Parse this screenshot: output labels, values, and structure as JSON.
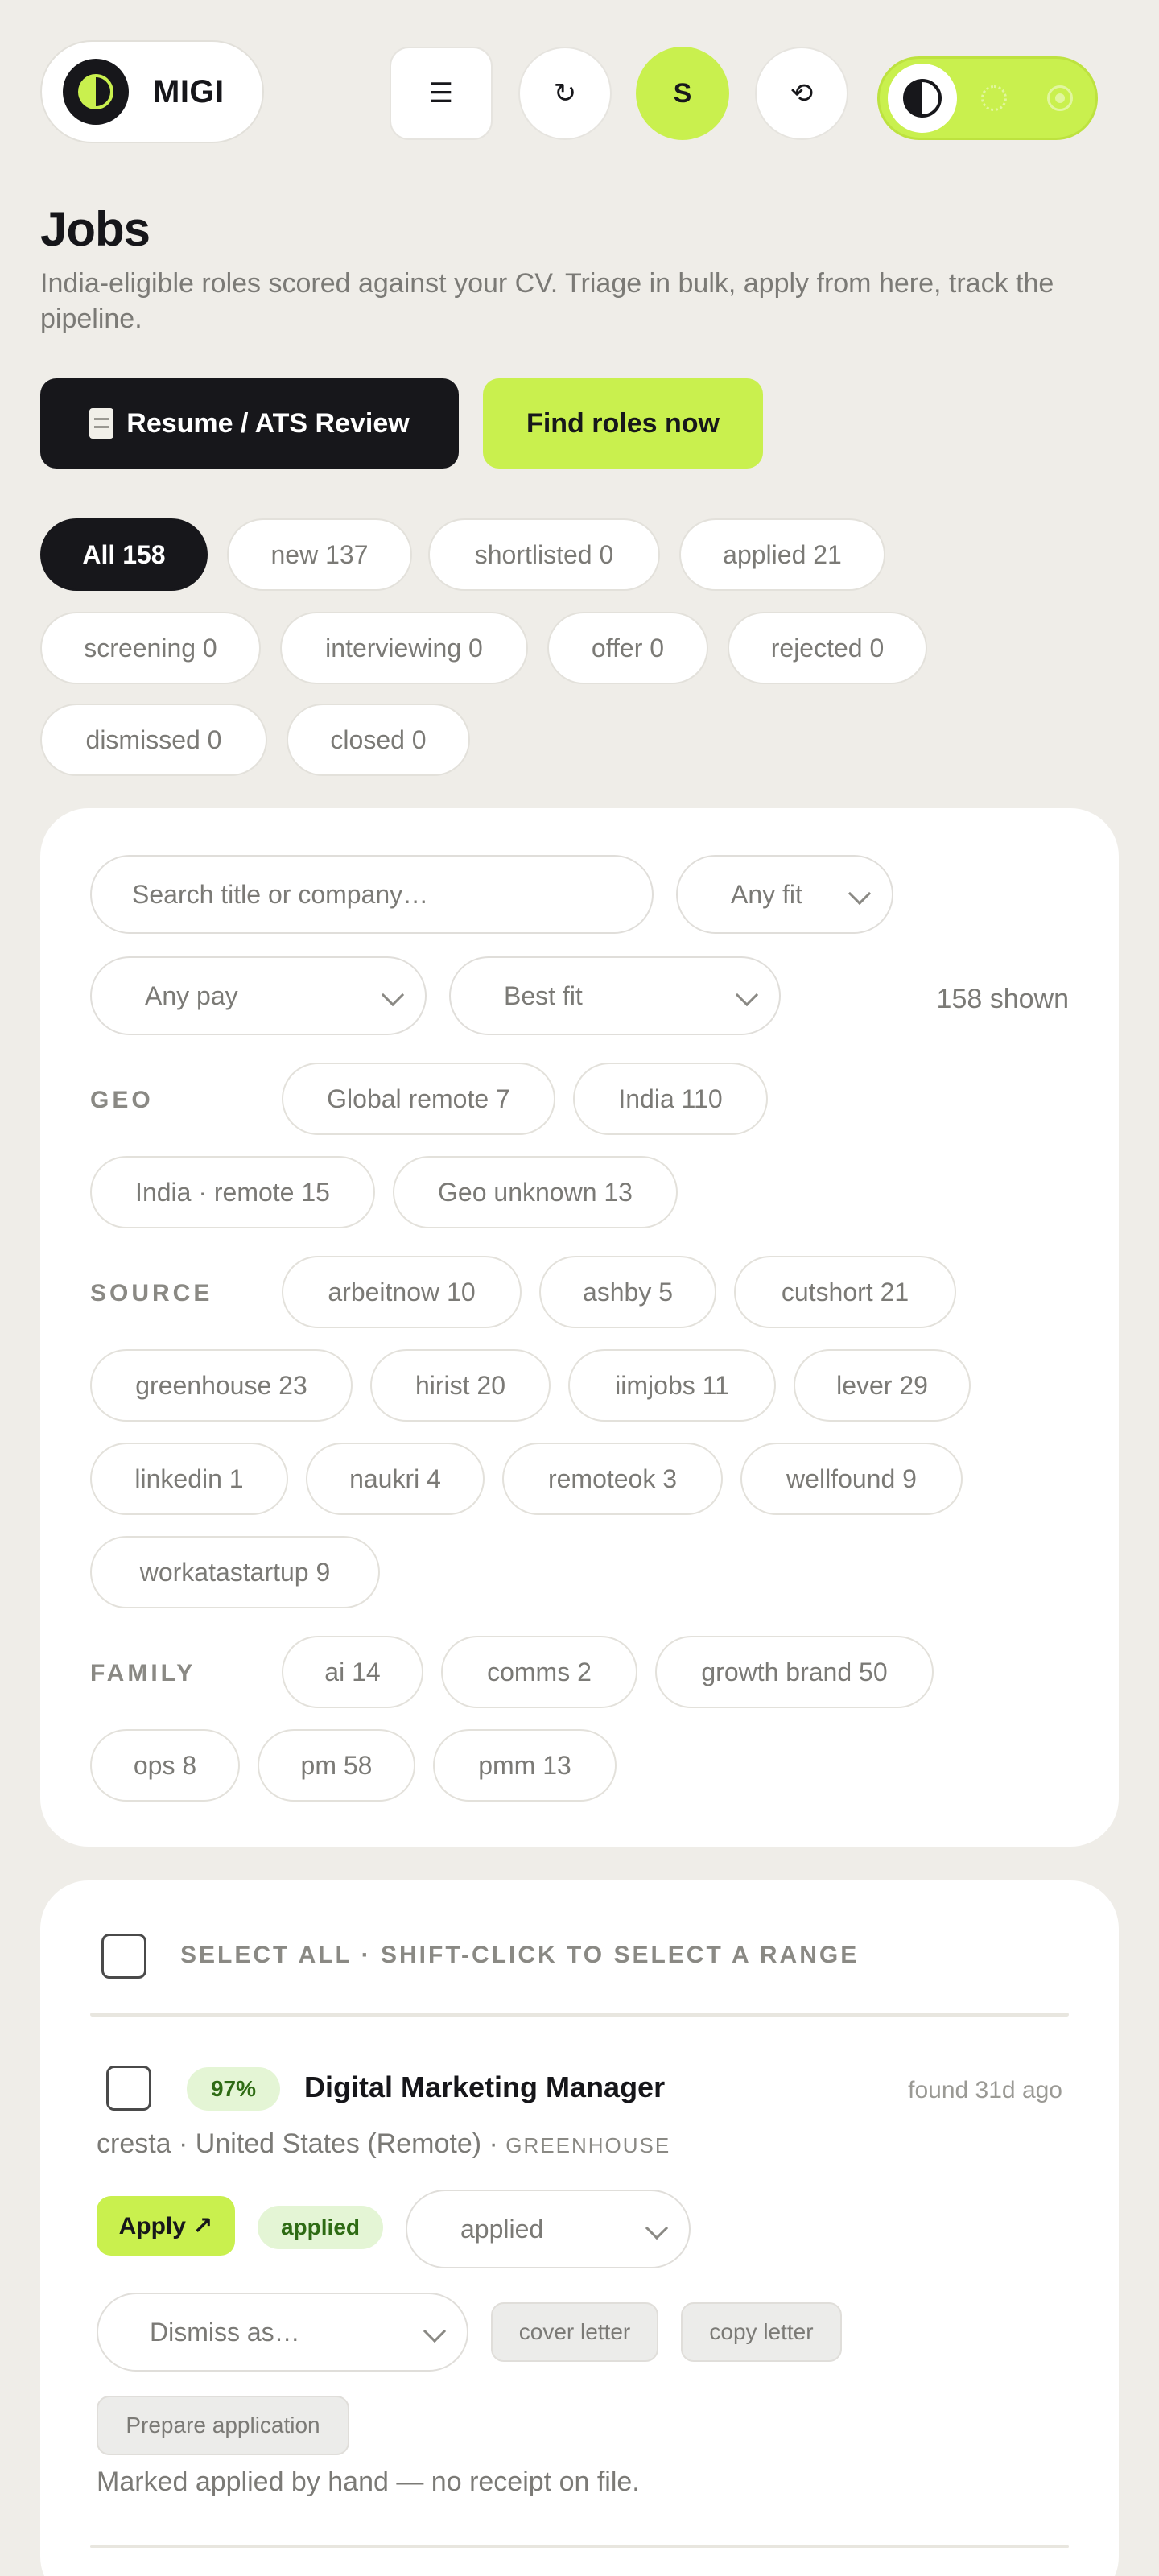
{
  "header": {
    "brand_name": "MIGI",
    "menu_icon": "☰",
    "refresh_icon": "↻",
    "avatar_initial": "S",
    "history_icon": "⟲"
  },
  "page": {
    "title": "Jobs",
    "subtitle": "India-eligible roles scored against your CV. Triage in bulk, apply from here, track the pipeline.",
    "resume_button": "Resume / ATS Review",
    "find_button": "Find roles now"
  },
  "status_filters": [
    {
      "label": "All 158",
      "active": true
    },
    {
      "label": "new 137"
    },
    {
      "label": "shortlisted 0"
    },
    {
      "label": "applied 21"
    },
    {
      "label": "screening 0"
    },
    {
      "label": "interviewing 0"
    },
    {
      "label": "offer 0"
    },
    {
      "label": "rejected 0"
    },
    {
      "label": "dismissed 0"
    },
    {
      "label": "closed 0"
    }
  ],
  "filters": {
    "search_placeholder": "Search title or company…",
    "fit_select": "Any fit",
    "pay_select": "Any pay",
    "sort_select": "Best fit",
    "shown_count": "158 shown",
    "geo_label": "GEO",
    "geo": [
      "Global remote 7",
      "India 110",
      "India · remote 15",
      "Geo unknown 13"
    ],
    "source_label": "SOURCE",
    "source": [
      "arbeitnow 10",
      "ashby 5",
      "cutshort 21",
      "greenhouse 23",
      "hirist 20",
      "iimjobs 11",
      "lever 29",
      "linkedin 1",
      "naukri 4",
      "remoteok 3",
      "wellfound 9",
      "workatastartup 9"
    ],
    "family_label": "FAMILY",
    "family": [
      "ai 14",
      "comms 2",
      "growth brand 50",
      "ops 8",
      "pm 58",
      "pmm 13"
    ]
  },
  "jobs": {
    "select_all": "SELECT ALL · SHIFT-CLICK TO SELECT A RANGE",
    "items": [
      {
        "fit": "97%",
        "title": "Digital Marketing Manager",
        "found": "found 31d ago",
        "company_location": "cresta · United States (Remote)",
        "source": "GREENHOUSE",
        "apply": "Apply ↗",
        "status_badge": "applied",
        "status_select": "applied",
        "dismiss_select": "Dismiss as…",
        "cover_letter": "cover letter",
        "copy_letter": "copy letter",
        "prepare": "Prepare application",
        "note": "Marked applied by hand — no receipt on file."
      }
    ]
  }
}
